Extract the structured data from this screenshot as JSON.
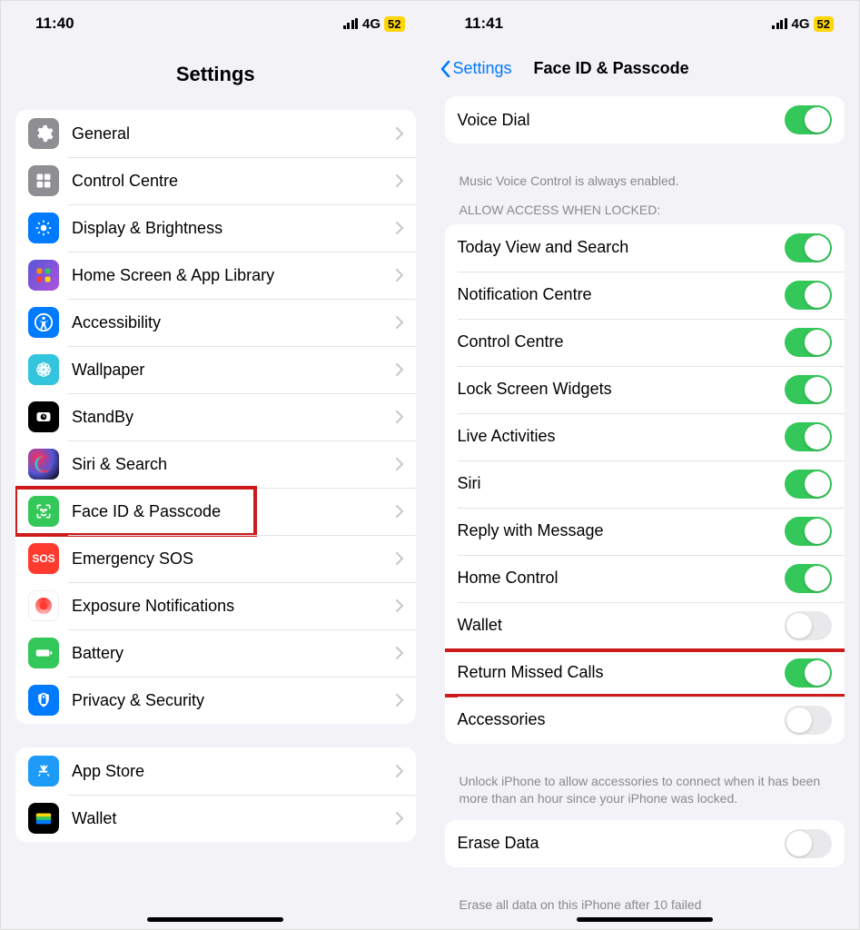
{
  "left": {
    "status": {
      "time": "11:40",
      "network": "4G",
      "battery": "52"
    },
    "title": "Settings",
    "groups": [
      {
        "rows": [
          {
            "id": "general",
            "label": "General",
            "icon": "gear-icon",
            "cls": "ic-general"
          },
          {
            "id": "control-centre",
            "label": "Control Centre",
            "icon": "control-centre-icon",
            "cls": "ic-control"
          },
          {
            "id": "display",
            "label": "Display & Brightness",
            "icon": "display-icon",
            "cls": "ic-display"
          },
          {
            "id": "home-screen",
            "label": "Home Screen & App Library",
            "icon": "home-screen-icon",
            "cls": "ic-home"
          },
          {
            "id": "accessibility",
            "label": "Accessibility",
            "icon": "accessibility-icon",
            "cls": "ic-access"
          },
          {
            "id": "wallpaper",
            "label": "Wallpaper",
            "icon": "wallpaper-icon",
            "cls": "ic-wall"
          },
          {
            "id": "standby",
            "label": "StandBy",
            "icon": "standby-icon",
            "cls": "ic-standby"
          },
          {
            "id": "siri",
            "label": "Siri & Search",
            "icon": "siri-icon",
            "cls": "ic-siri"
          },
          {
            "id": "faceid",
            "label": "Face ID & Passcode",
            "icon": "faceid-icon",
            "cls": "ic-faceid",
            "highlight": true
          },
          {
            "id": "sos",
            "label": "Emergency SOS",
            "icon": "sos-icon",
            "cls": "ic-sos"
          },
          {
            "id": "exposure",
            "label": "Exposure Notifications",
            "icon": "exposure-icon",
            "cls": "ic-exposure"
          },
          {
            "id": "battery",
            "label": "Battery",
            "icon": "battery-icon",
            "cls": "ic-battery"
          },
          {
            "id": "privacy",
            "label": "Privacy & Security",
            "icon": "privacy-icon",
            "cls": "ic-privacy"
          }
        ]
      },
      {
        "rows": [
          {
            "id": "appstore",
            "label": "App Store",
            "icon": "appstore-icon",
            "cls": "ic-appstore"
          },
          {
            "id": "wallet",
            "label": "Wallet",
            "icon": "wallet-icon",
            "cls": "ic-wallet"
          }
        ]
      }
    ]
  },
  "right": {
    "status": {
      "time": "11:41",
      "network": "4G",
      "battery": "52"
    },
    "back": "Settings",
    "title": "Face ID & Passcode",
    "voicedial": {
      "label": "Voice Dial",
      "on": true
    },
    "voicedial_footer": "Music Voice Control is always enabled.",
    "allow_header": "Allow Access When Locked:",
    "access_rows": [
      {
        "id": "today-view",
        "label": "Today View and Search",
        "on": true
      },
      {
        "id": "notification-centre",
        "label": "Notification Centre",
        "on": true
      },
      {
        "id": "control-centre",
        "label": "Control Centre",
        "on": true
      },
      {
        "id": "lock-widgets",
        "label": "Lock Screen Widgets",
        "on": true
      },
      {
        "id": "live-activities",
        "label": "Live Activities",
        "on": true
      },
      {
        "id": "siri",
        "label": "Siri",
        "on": true
      },
      {
        "id": "reply-message",
        "label": "Reply with Message",
        "on": true
      },
      {
        "id": "home-control",
        "label": "Home Control",
        "on": true
      },
      {
        "id": "wallet-access",
        "label": "Wallet",
        "on": false
      },
      {
        "id": "return-missed",
        "label": "Return Missed Calls",
        "on": true,
        "highlight": true
      },
      {
        "id": "accessories",
        "label": "Accessories",
        "on": false
      }
    ],
    "access_footer": "Unlock iPhone to allow accessories to connect when it has been more than an hour since your iPhone was locked.",
    "erase": {
      "label": "Erase Data",
      "on": false
    },
    "erase_footer": "Erase all data on this iPhone after 10 failed"
  },
  "icons": {
    "gear-icon": "<svg viewBox='0 0 24 24' width='22' height='22' fill='white'><path d='M12 8a4 4 0 100 8 4 4 0 000-8zm9.4 4a7.6 7.6 0 00-.1-1.3l2.1-1.6-2-3.5-2.5 1a7.7 7.7 0 00-2.2-1.3L16 2h-4l-.7 2.6a7.7 7.7 0 00-2.2 1.3l-2.5-1-2 3.5 2.1 1.6a7.6 7.6 0 000 2.6L4.6 14.2l2 3.5 2.5-1a7.7 7.7 0 002.2 1.3L12 22h4l.7-2.6a7.7 7.7 0 002.2-1.3l2.5 1 2-3.5-2.1-1.6c.1-.4.1-.9.1-1.3z'/></svg>",
    "control-centre-icon": "<svg viewBox='0 0 24 24' width='20' height='20' fill='white'><rect x='3' y='3' width='8' height='8' rx='2'/><rect x='13' y='3' width='8' height='8' rx='2'/><rect x='3' y='13' width='8' height='8' rx='2'/><rect x='13' y='13' width='8' height='8' rx='2'/></svg>",
    "display-icon": "<svg viewBox='0 0 24 24' width='20' height='20' fill='white'><circle cx='12' cy='12' r='4'/><g stroke='white' stroke-width='2'><line x1='12' y1='2' x2='12' y2='5'/><line x1='12' y1='19' x2='12' y2='22'/><line x1='2' y1='12' x2='5' y2='12'/><line x1='19' y1='12' x2='22' y2='12'/><line x1='4.9' y1='4.9' x2='7' y2='7'/><line x1='17' y1='17' x2='19.1' y2='19.1'/><line x1='4.9' y1='19.1' x2='7' y2='17'/><line x1='17' y1='7' x2='19.1' y2='4.9'/></g></svg>",
    "home-screen-icon": "<svg viewBox='0 0 24 24' width='20' height='20'><rect x='3' y='3' width='7' height='7' rx='2' fill='#ff9500'/><rect x='14' y='3' width='7' height='7' rx='2' fill='#34c759'/><rect x='3' y='14' width='7' height='7' rx='2' fill='#ff3b30'/><rect x='14' y='14' width='7' height='7' rx='2' fill='#ffd60a'/></svg>",
    "accessibility-icon": "<svg viewBox='0 0 24 24' width='22' height='22' fill='white'><circle cx='12' cy='12' r='10' fill='none' stroke='white' stroke-width='2'/><circle cx='12' cy='7' r='1.8'/><path d='M6 10l6 1 6-1-4 2v3l2 5-2 .5-2-5-2 5-2-.5 2-5v-3z'/></svg>",
    "wallpaper-icon": "<svg viewBox='0 0 24 24' width='22' height='22' fill='none' stroke='white' stroke-width='1.5'><circle cx='12' cy='12' r='3'/><circle cx='12' cy='7' r='3'/><circle cx='12' cy='17' r='3'/><circle cx='7' cy='12' r='3'/><circle cx='17' cy='12' r='3'/><circle cx='8.5' cy='8.5' r='3'/><circle cx='15.5' cy='8.5' r='3'/><circle cx='8.5' cy='15.5' r='3'/><circle cx='15.5' cy='15.5' r='3'/></svg>",
    "standby-icon": "<svg viewBox='0 0 24 24' width='20' height='20' fill='white'><rect x='3' y='6' width='18' height='12' rx='3' fill='white'/><circle cx='12' cy='12' r='4' fill='black'/><line x1='12' y1='12' x2='12' y2='9' stroke='white' stroke-width='1.2'/><line x1='12' y1='12' x2='14' y2='12' stroke='white' stroke-width='1.2'/></svg>",
    "siri-icon": "<svg viewBox='0 0 24 24' width='22' height='22'><circle cx='12' cy='12' r='9' fill='none' stroke='url(#g)' stroke-width='3'/><defs><linearGradient id='g'><stop offset='0' stop-color='#34c5de'/><stop offset='.5' stop-color='#ff2d55'/><stop offset='1' stop-color='#5856d6'/></linearGradient></defs></svg>",
    "faceid-icon": "<svg viewBox='0 0 24 24' width='20' height='20' fill='none' stroke='white' stroke-width='2' stroke-linecap='round'><path d='M4 8V5a1 1 0 011-1h3M20 8V5a1 1 0 00-1-1h-3M4 16v3a1 1 0 001 1h3M20 16v3a1 1 0 01-1 1h-3'/><circle cx='9' cy='10' r='.8' fill='white'/><circle cx='15' cy='10' r='.8' fill='white'/><path d='M12 10v3h-1M9 16s1 1.5 3 1.5 3-1.5 3-1.5'/></svg>",
    "sos-icon": "SOS",
    "exposure-icon": "EXP",
    "battery-icon": "<svg viewBox='0 0 24 24' width='22' height='22' fill='white'><rect x='3' y='8' width='16' height='8' rx='2'/><rect x='20' y='10' width='2' height='4' rx='1'/></svg>",
    "privacy-icon": "<svg viewBox='0 0 24 24' width='20' height='20' fill='white'><path d='M12 2l7 3v5c0 5-3 9-7 11-4-2-7-6-7-11V5l7-3z'/><rect x='9' y='9' width='6' height='8' rx='1' fill='#007aff'/><path d='M10 9V7a2 2 0 014 0v2' fill='none' stroke='#007aff' stroke-width='1.5'/></svg>",
    "appstore-icon": "<svg viewBox='0 0 24 24' width='20' height='20' fill='white'><path d='M12 4l-1.5 2.6L9 4 7.3 5l3.8 6.6H6.5L5.5 14h11l1-2.4h-4.6L17.7 5 16 4l-1.5 2.6L13 4zM6 16l-1.2 2.1L6.5 19l1.7-3zm10.3 0l1.7 3 1.7-.9L18.5 16z'/></svg>",
    "wallet-icon": "<svg viewBox='0 0 24 24' width='22' height='22'><rect x='3' y='6' width='18' height='5' rx='2' fill='#ffd60a'/><rect x='3' y='10' width='18' height='5' rx='2' fill='#34c759'/><rect x='3' y='14' width='18' height='5' rx='2' fill='#007aff'/></svg>"
  }
}
